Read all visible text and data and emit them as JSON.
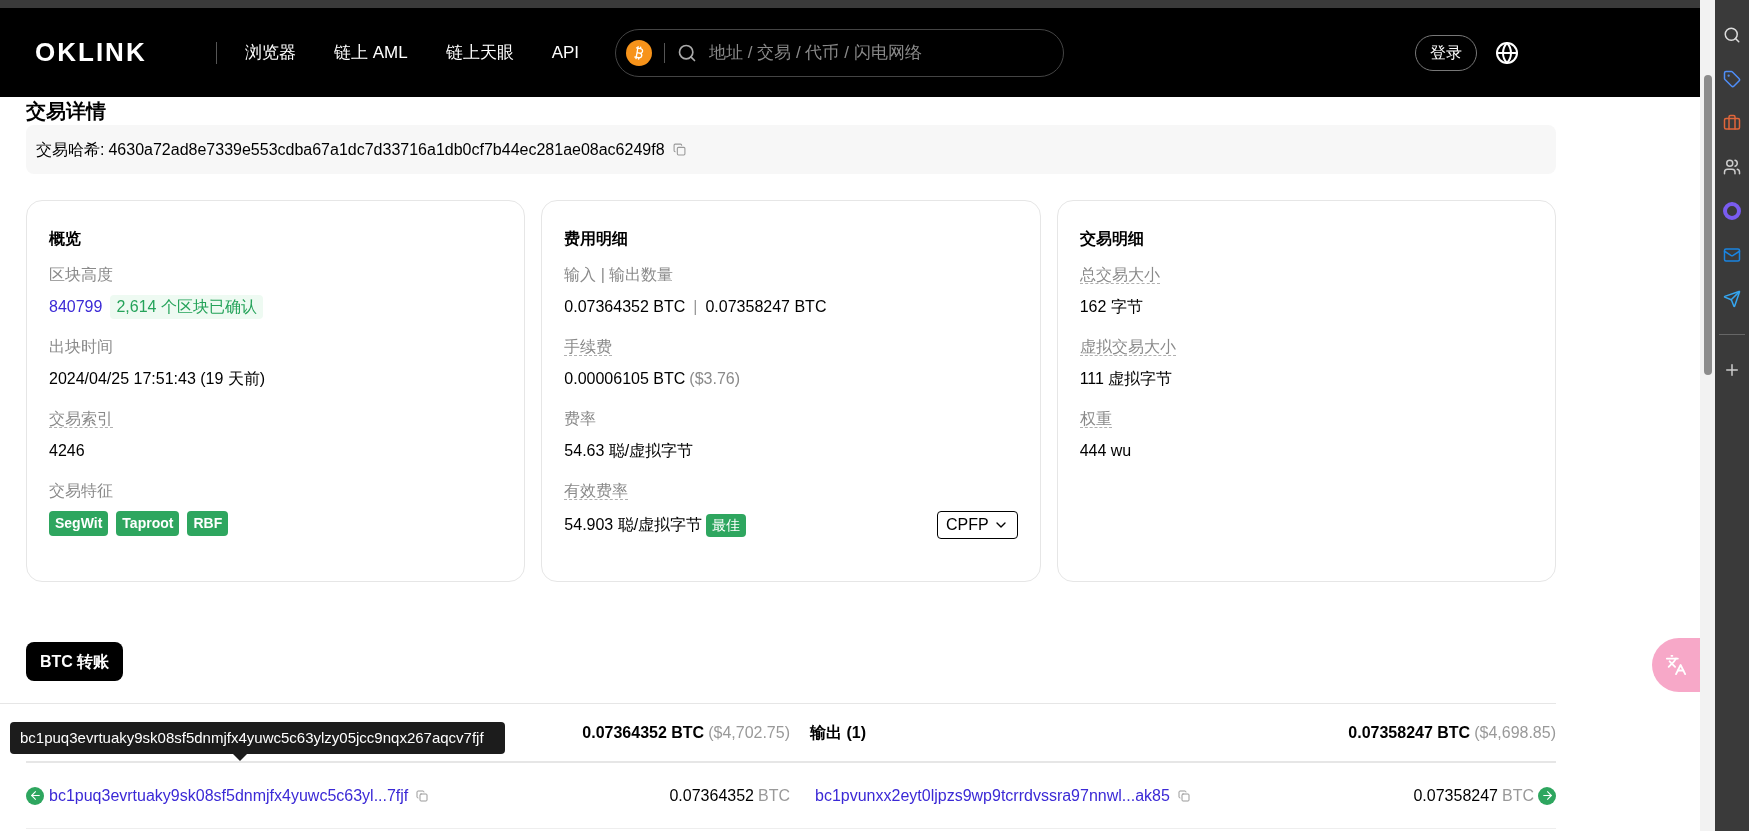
{
  "header": {
    "logo": "OKLINK",
    "nav": [
      "浏览器",
      "链上 AML",
      "链上天眼",
      "API"
    ],
    "search": {
      "placeholder": "地址 / 交易 / 代币 / 闪电网络"
    },
    "login": "登录"
  },
  "page_title": "交易详情",
  "hash": {
    "label": "交易哈希:",
    "value": "4630a72ad8e7339e553cdba67a1dc7d33716a1db0cf7b44ec281ae08ac6249f8"
  },
  "cards": [
    {
      "title": "概览",
      "fields": [
        {
          "label": "区块高度",
          "dotted": false,
          "kind": "block",
          "link": "840799",
          "note": "2,614 个区块已确认"
        },
        {
          "label": "出块时间",
          "dotted": false,
          "kind": "text",
          "value": "2024/04/25 17:51:43 (19 天前)"
        },
        {
          "label": "交易索引",
          "dotted": true,
          "kind": "text",
          "value": "4246"
        },
        {
          "label": "交易特征",
          "dotted": false,
          "kind": "tags",
          "tags": [
            "SegWit",
            "Taproot",
            "RBF"
          ]
        }
      ]
    },
    {
      "title": "费用明细",
      "fields": [
        {
          "label": "输入 | 输出数量",
          "dotted": false,
          "kind": "pair",
          "values": [
            "0.07364352 BTC",
            "0.07358247 BTC"
          ],
          "separator": "|"
        },
        {
          "label": "手续费",
          "dotted": true,
          "kind": "fee",
          "value": "0.00006105 BTC",
          "usd": "($3.76)"
        },
        {
          "label": "费率",
          "dotted": false,
          "kind": "text",
          "value": "54.63 聪/虚拟字节"
        },
        {
          "label": "有效费率",
          "dotted": true,
          "kind": "rate",
          "value": "54.903 聪/虚拟字节",
          "badge": "最佳",
          "dropdown": "CPFP"
        }
      ]
    },
    {
      "title": "交易明细",
      "fields": [
        {
          "label": "总交易大小",
          "dotted": true,
          "kind": "text",
          "value": "162 字节"
        },
        {
          "label": "虚拟交易大小",
          "dotted": true,
          "kind": "text",
          "value": "111 虚拟字节"
        },
        {
          "label": "权重",
          "dotted": true,
          "kind": "text",
          "value": "444 wu"
        }
      ]
    }
  ],
  "transfer": {
    "tab": "BTC 转账",
    "inputs": {
      "total": "0.07364352 BTC",
      "usd": "($4,702.75)",
      "rows": [
        {
          "address": "bc1puq3evrtuaky9sk08sf5dnmjfx4yuwc5c63yl...7fjf",
          "amount": "0.07364352",
          "unit": "BTC"
        }
      ]
    },
    "outputs": {
      "title": "输出 (1)",
      "total": "0.07358247 BTC",
      "usd": "($4,698.85)",
      "rows": [
        {
          "address": "bc1pvunxx2eyt0ljpzs9wp9tcrrdvssra97nnwl...ak85",
          "amount": "0.07358247",
          "unit": "BTC"
        }
      ]
    },
    "tooltip": "bc1puq3evrtuaky9sk08sf5dnmjfx4yuwc5c63ylzy05jcc9nqx267aqcv7fjf"
  }
}
